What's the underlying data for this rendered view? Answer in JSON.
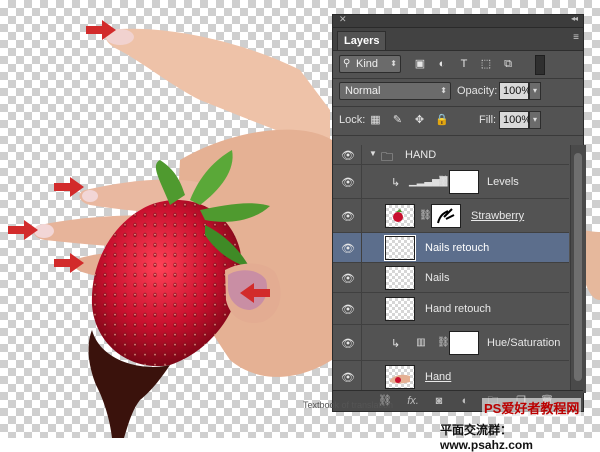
{
  "panel": {
    "tab_label": "Layers",
    "close_glyph": "✕",
    "collapse_glyph": "◂◂",
    "menu_glyph": "≡",
    "filter": {
      "kind_label": "Kind"
    },
    "blend_mode": "Normal",
    "opacity_label": "Opacity:",
    "opacity_value": "100%",
    "lock_label": "Lock:",
    "fill_label": "Fill:",
    "fill_value": "100%"
  },
  "layers": [
    {
      "name": "HAND",
      "kind": "group"
    },
    {
      "name": "Levels",
      "kind": "adjustment"
    },
    {
      "name": "Strawberry",
      "kind": "smart"
    },
    {
      "name": "Nails retouch",
      "kind": "pixel",
      "selected": true
    },
    {
      "name": "Nails",
      "kind": "pixel"
    },
    {
      "name": "Hand retouch",
      "kind": "pixel"
    },
    {
      "name": "Hue/Saturation",
      "kind": "adjustment"
    },
    {
      "name": "Hand",
      "kind": "pixel"
    }
  ],
  "footer": {
    "fx_label": "fx."
  },
  "watermarks": {
    "brand": "PS爱好者教程网",
    "site": "平面交流群：www.psahz.com",
    "caption": "Textbook of translation"
  },
  "colors": {
    "panel_bg": "#535353",
    "selection": "#5c6e8c",
    "arrow": "#d22b2b",
    "strawberry": "#c8102e"
  }
}
